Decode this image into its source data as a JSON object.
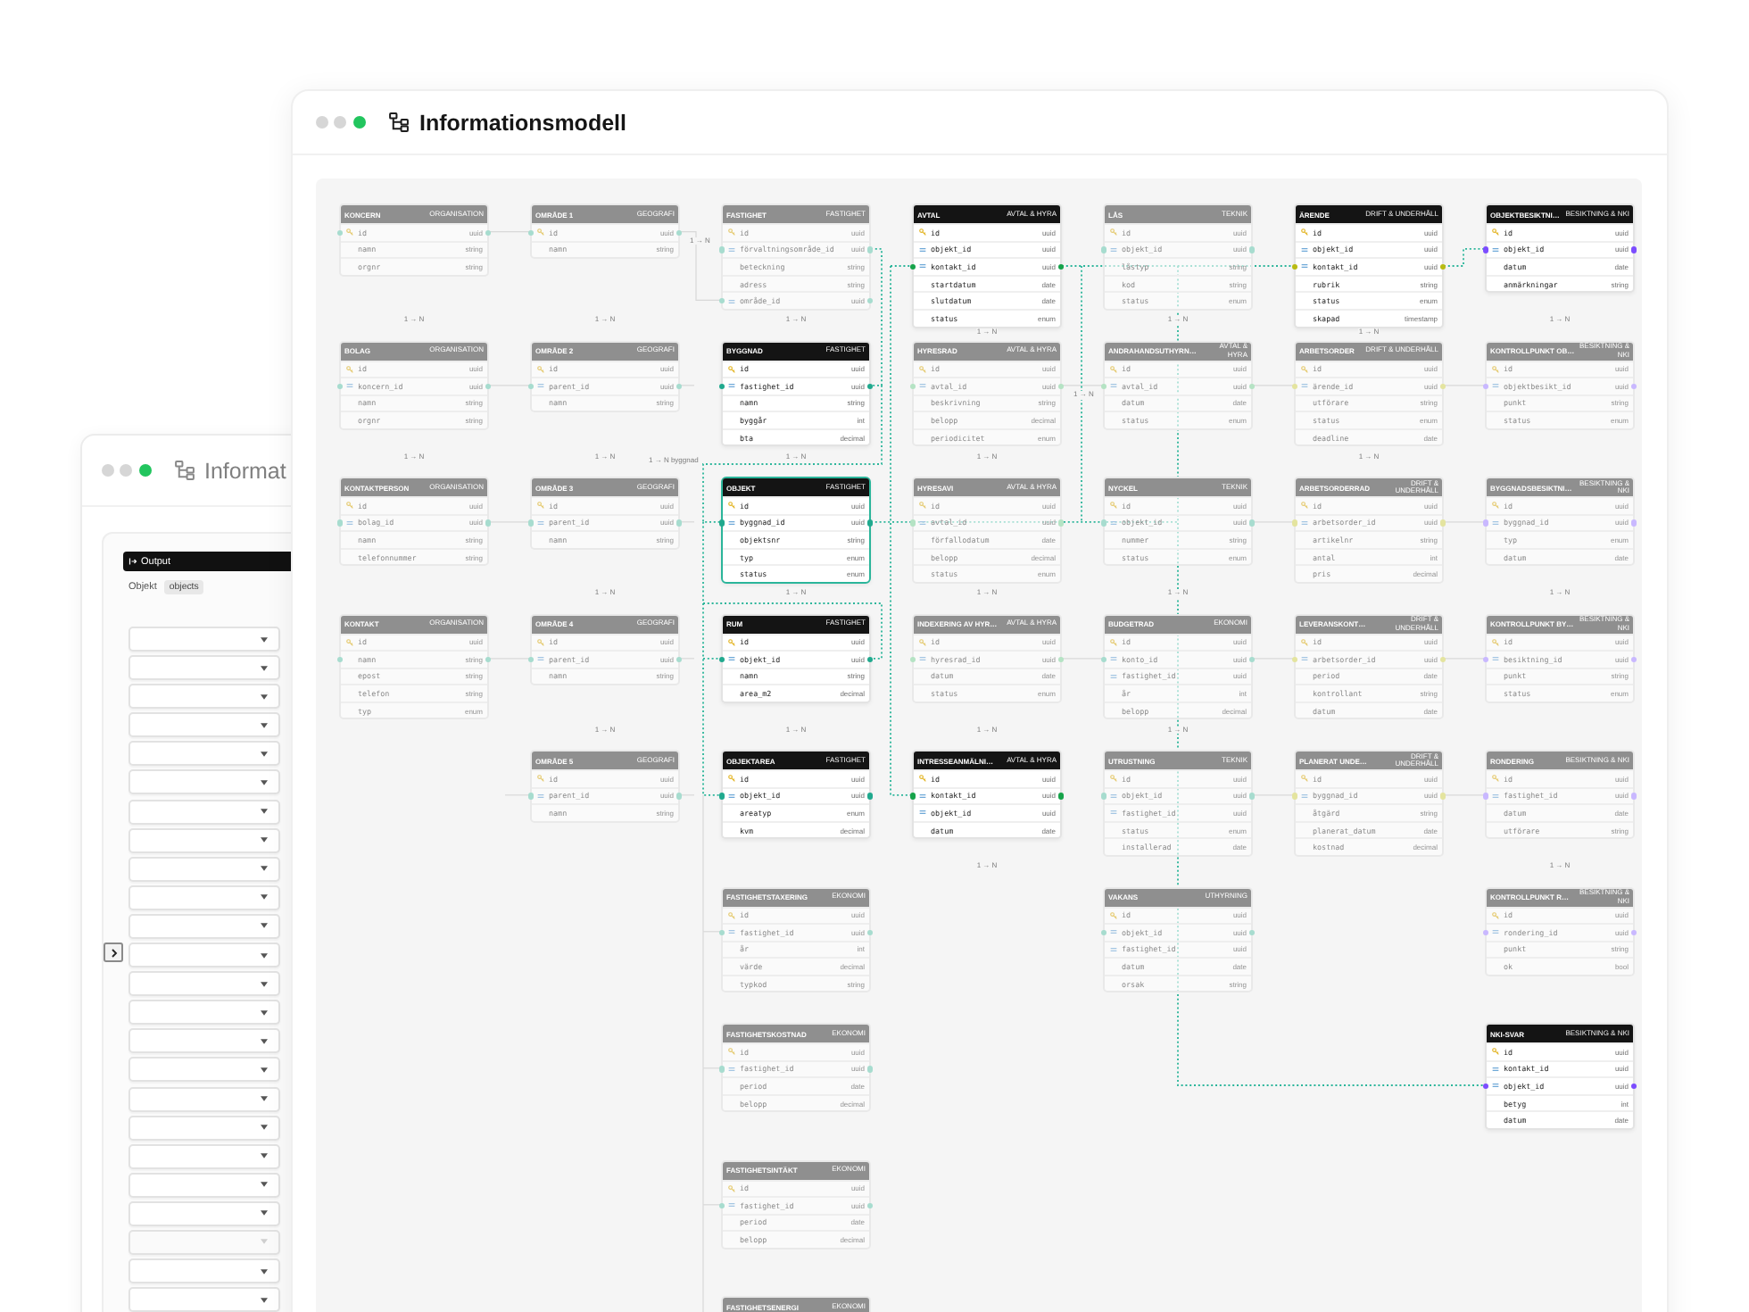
{
  "back_window": {
    "title": "Informat",
    "output": {
      "title": "Output",
      "object_label": "Objekt",
      "object_value": "objects",
      "dropdowns": [
        {
          "disabled": false
        },
        {
          "disabled": false
        },
        {
          "disabled": false
        },
        {
          "disabled": false
        },
        {
          "disabled": false
        },
        {
          "disabled": false
        },
        {
          "disabled": false
        },
        {
          "disabled": false
        },
        {
          "disabled": false
        },
        {
          "disabled": false
        },
        {
          "disabled": false
        },
        {
          "disabled": false
        },
        {
          "disabled": false
        },
        {
          "disabled": false
        },
        {
          "disabled": false
        },
        {
          "disabled": false
        },
        {
          "disabled": false
        },
        {
          "disabled": false
        },
        {
          "disabled": false
        },
        {
          "disabled": false
        },
        {
          "disabled": false
        },
        {
          "disabled": true
        },
        {
          "disabled": false
        },
        {
          "disabled": false
        }
      ]
    }
  },
  "window": {
    "title": "Informationsmodell"
  },
  "diagram": {
    "line_labels": [
      "1 → N",
      "1 → N",
      "1 → N byggnad"
    ],
    "columns": [
      {
        "tables": [
          {
            "title": "KONCERN",
            "group": "ORGANISATION",
            "dimmed": true,
            "selected": false,
            "color": "#a7dccf",
            "relation_label": "1 → N",
            "fields": [
              {
                "name": "id",
                "type": "uuid",
                "kind": "pk",
                "linked": true
              },
              {
                "name": "namn",
                "type": "string",
                "kind": "plain"
              },
              {
                "name": "orgnr",
                "type": "string",
                "kind": "plain"
              }
            ]
          },
          {
            "title": "BOLAG",
            "group": "ORGANISATION",
            "dimmed": true,
            "selected": false,
            "color": "#a7dccf",
            "relation_label": "1 → N",
            "fields": [
              {
                "name": "id",
                "type": "uuid",
                "kind": "pk"
              },
              {
                "name": "koncern_id",
                "type": "uuid",
                "kind": "fk",
                "linked": true
              },
              {
                "name": "namn",
                "type": "string",
                "kind": "plain"
              },
              {
                "name": "orgnr",
                "type": "string",
                "kind": "plain"
              }
            ]
          },
          {
            "title": "KONTAKTPERSON",
            "group": "ORGANISATION",
            "dimmed": true,
            "selected": false,
            "color": "#a7dccf",
            "fields": [
              {
                "name": "id",
                "type": "uuid",
                "kind": "pk"
              },
              {
                "name": "bolag_id",
                "type": "uuid",
                "kind": "fk",
                "linked": true
              },
              {
                "name": "namn",
                "type": "string",
                "kind": "plain"
              },
              {
                "name": "telefonnummer",
                "type": "string",
                "kind": "plain"
              }
            ]
          },
          {
            "title": "KONTAKT",
            "group": "ORGANISATION",
            "dimmed": true,
            "selected": false,
            "color": "#a7dccf",
            "fields": [
              {
                "name": "id",
                "type": "uuid",
                "kind": "pk"
              },
              {
                "name": "namn",
                "type": "string",
                "kind": "plain",
                "linked": true
              },
              {
                "name": "epost",
                "type": "string",
                "kind": "plain"
              },
              {
                "name": "telefon",
                "type": "string",
                "kind": "plain"
              },
              {
                "name": "typ",
                "type": "enum",
                "kind": "plain"
              }
            ]
          }
        ]
      },
      {
        "tables": [
          {
            "title": "OMRÅDE 1",
            "group": "GEOGRAFI",
            "dimmed": true,
            "selected": false,
            "color": "#a7dccf",
            "relation_label": "1 → N",
            "fields": [
              {
                "name": "id",
                "type": "uuid",
                "kind": "pk",
                "linked": true
              },
              {
                "name": "namn",
                "type": "string",
                "kind": "plain"
              }
            ]
          },
          {
            "title": "OMRÅDE 2",
            "group": "GEOGRAFI",
            "dimmed": true,
            "selected": false,
            "color": "#a7dccf",
            "relation_label": "1 → N",
            "fields": [
              {
                "name": "id",
                "type": "uuid",
                "kind": "pk"
              },
              {
                "name": "parent_id",
                "type": "uuid",
                "kind": "fk",
                "linked": true
              },
              {
                "name": "namn",
                "type": "string",
                "kind": "plain"
              }
            ]
          },
          {
            "title": "OMRÅDE 3",
            "group": "GEOGRAFI",
            "dimmed": true,
            "selected": false,
            "color": "#a7dccf",
            "relation_label": "1 → N",
            "fields": [
              {
                "name": "id",
                "type": "uuid",
                "kind": "pk"
              },
              {
                "name": "parent_id",
                "type": "uuid",
                "kind": "fk",
                "linked": true
              },
              {
                "name": "namn",
                "type": "string",
                "kind": "plain"
              }
            ]
          },
          {
            "title": "OMRÅDE 4",
            "group": "GEOGRAFI",
            "dimmed": true,
            "selected": false,
            "color": "#a7dccf",
            "relation_label": "1 → N",
            "fields": [
              {
                "name": "id",
                "type": "uuid",
                "kind": "pk"
              },
              {
                "name": "parent_id",
                "type": "uuid",
                "kind": "fk",
                "linked": true
              },
              {
                "name": "namn",
                "type": "string",
                "kind": "plain"
              }
            ]
          },
          {
            "title": "OMRÅDE 5",
            "group": "GEOGRAFI",
            "dimmed": true,
            "selected": false,
            "color": "#a7dccf",
            "fields": [
              {
                "name": "id",
                "type": "uuid",
                "kind": "pk"
              },
              {
                "name": "parent_id",
                "type": "uuid",
                "kind": "fk",
                "linked": true
              },
              {
                "name": "namn",
                "type": "string",
                "kind": "plain"
              }
            ]
          }
        ]
      },
      {
        "tables": [
          {
            "title": "FASTIGHET",
            "group": "FASTIGHET",
            "dimmed": true,
            "selected": false,
            "color": "#a7dccf",
            "relation_label": "1 → N",
            "fields": [
              {
                "name": "id",
                "type": "uuid",
                "kind": "pk"
              },
              {
                "name": "förvaltningsområde_id",
                "type": "uuid",
                "kind": "fk",
                "linked": true
              },
              {
                "name": "beteckning",
                "type": "string",
                "kind": "plain"
              },
              {
                "name": "adress",
                "type": "string",
                "kind": "plain"
              },
              {
                "name": "område_id",
                "type": "uuid",
                "kind": "fk",
                "linked": true
              }
            ]
          },
          {
            "title": "BYGGNAD",
            "group": "FASTIGHET",
            "dimmed": false,
            "selected": false,
            "color": "#20a98e",
            "relation_label": "1 → N",
            "fields": [
              {
                "name": "id",
                "type": "uuid",
                "kind": "pk"
              },
              {
                "name": "fastighet_id",
                "type": "uuid",
                "kind": "fk",
                "linked": true
              },
              {
                "name": "namn",
                "type": "string",
                "kind": "plain"
              },
              {
                "name": "byggår",
                "type": "int",
                "kind": "plain"
              },
              {
                "name": "bta",
                "type": "decimal",
                "kind": "plain"
              }
            ]
          },
          {
            "title": "OBJEKT",
            "group": "FASTIGHET",
            "dimmed": false,
            "selected": true,
            "color": "#20a98e",
            "relation_label": "1 → N",
            "fields": [
              {
                "name": "id",
                "type": "uuid",
                "kind": "pk"
              },
              {
                "name": "byggnad_id",
                "type": "uuid",
                "kind": "fk",
                "linked": true
              },
              {
                "name": "objektsnr",
                "type": "string",
                "kind": "plain"
              },
              {
                "name": "typ",
                "type": "enum",
                "kind": "plain"
              },
              {
                "name": "status",
                "type": "enum",
                "kind": "plain"
              }
            ]
          },
          {
            "title": "RUM",
            "group": "FASTIGHET",
            "dimmed": false,
            "selected": false,
            "color": "#20a98e",
            "relation_label": "1 → N",
            "fields": [
              {
                "name": "id",
                "type": "uuid",
                "kind": "pk"
              },
              {
                "name": "objekt_id",
                "type": "uuid",
                "kind": "fk",
                "linked": true
              },
              {
                "name": "namn",
                "type": "string",
                "kind": "plain"
              },
              {
                "name": "area_m2",
                "type": "decimal",
                "kind": "plain"
              }
            ]
          },
          {
            "title": "OBJEKTAREA",
            "group": "FASTIGHET",
            "dimmed": false,
            "selected": false,
            "color": "#20a98e",
            "fields": [
              {
                "name": "id",
                "type": "uuid",
                "kind": "pk"
              },
              {
                "name": "objekt_id",
                "type": "uuid",
                "kind": "fk",
                "linked": true
              },
              {
                "name": "areatyp",
                "type": "enum",
                "kind": "plain"
              },
              {
                "name": "kvm",
                "type": "decimal",
                "kind": "plain"
              }
            ]
          },
          {
            "title": "FASTIGHETSTAXERING",
            "group": "EKONOMI",
            "dimmed": true,
            "selected": false,
            "color": "#a7dccf",
            "fields": [
              {
                "name": "id",
                "type": "uuid",
                "kind": "pk"
              },
              {
                "name": "fastighet_id",
                "type": "uuid",
                "kind": "fk",
                "linked": true
              },
              {
                "name": "år",
                "type": "int",
                "kind": "plain"
              },
              {
                "name": "värde",
                "type": "decimal",
                "kind": "plain"
              },
              {
                "name": "typkod",
                "type": "string",
                "kind": "plain"
              }
            ]
          },
          {
            "title": "FASTIGHETSKOSTNAD",
            "group": "EKONOMI",
            "dimmed": true,
            "selected": false,
            "color": "#a7dccf",
            "fields": [
              {
                "name": "id",
                "type": "uuid",
                "kind": "pk"
              },
              {
                "name": "fastighet_id",
                "type": "uuid",
                "kind": "fk",
                "linked": true
              },
              {
                "name": "period",
                "type": "date",
                "kind": "plain"
              },
              {
                "name": "belopp",
                "type": "decimal",
                "kind": "plain"
              }
            ]
          },
          {
            "title": "FASTIGHETSINTÄKT",
            "group": "EKONOMI",
            "dimmed": true,
            "selected": false,
            "color": "#a7dccf",
            "fields": [
              {
                "name": "id",
                "type": "uuid",
                "kind": "pk"
              },
              {
                "name": "fastighet_id",
                "type": "uuid",
                "kind": "fk",
                "linked": true
              },
              {
                "name": "period",
                "type": "date",
                "kind": "plain"
              },
              {
                "name": "belopp",
                "type": "decimal",
                "kind": "plain"
              }
            ]
          },
          {
            "title": "FASTIGHETSENERGI",
            "group": "EKONOMI",
            "dimmed": true,
            "selected": false
          }
        ]
      },
      {
        "tables": [
          {
            "title": "AVTAL",
            "group": "AVTAL & HYRA",
            "dimmed": false,
            "selected": false,
            "color": "#16a34a",
            "relation_label": "1 → N",
            "fields": [
              {
                "name": "id",
                "type": "uuid",
                "kind": "pk"
              },
              {
                "name": "objekt_id",
                "type": "uuid",
                "kind": "fk"
              },
              {
                "name": "kontakt_id",
                "type": "uuid",
                "kind": "fk",
                "linked": true
              },
              {
                "name": "startdatum",
                "type": "date",
                "kind": "plain"
              },
              {
                "name": "slutdatum",
                "type": "date",
                "kind": "plain"
              },
              {
                "name": "status",
                "type": "enum",
                "kind": "plain"
              }
            ]
          },
          {
            "title": "HYRESRAD",
            "group": "AVTAL & HYRA",
            "dimmed": true,
            "selected": false,
            "color": "#b5e3c4",
            "relation_label": "1 → N",
            "fields": [
              {
                "name": "id",
                "type": "uuid",
                "kind": "pk"
              },
              {
                "name": "avtal_id",
                "type": "uuid",
                "kind": "fk",
                "linked": true
              },
              {
                "name": "beskrivning",
                "type": "string",
                "kind": "plain"
              },
              {
                "name": "belopp",
                "type": "decimal",
                "kind": "plain"
              },
              {
                "name": "periodicitet",
                "type": "enum",
                "kind": "plain"
              }
            ]
          },
          {
            "title": "HYRESAVI",
            "group": "AVTAL & HYRA",
            "dimmed": true,
            "selected": false,
            "color": "#b5e3c4",
            "relation_label": "1 → N",
            "fields": [
              {
                "name": "id",
                "type": "uuid",
                "kind": "pk"
              },
              {
                "name": "avtal_id",
                "type": "uuid",
                "kind": "fk",
                "linked": true
              },
              {
                "name": "förfallodatum",
                "type": "date",
                "kind": "plain"
              },
              {
                "name": "belopp",
                "type": "decimal",
                "kind": "plain"
              },
              {
                "name": "status",
                "type": "enum",
                "kind": "plain"
              }
            ]
          },
          {
            "title": "INDEXERING AV HYR…",
            "group": "AVTAL & HYRA",
            "dimmed": true,
            "selected": false,
            "color": "#b5e3c4",
            "relation_label": "1 → N",
            "fields": [
              {
                "name": "id",
                "type": "uuid",
                "kind": "pk"
              },
              {
                "name": "hyresrad_id",
                "type": "uuid",
                "kind": "fk",
                "linked": true
              },
              {
                "name": "datum",
                "type": "date",
                "kind": "plain"
              },
              {
                "name": "status",
                "type": "enum",
                "kind": "plain"
              }
            ]
          },
          {
            "title": "INTRESSEANMÄLNI…",
            "group": "AVTAL & HYRA",
            "dimmed": false,
            "selected": false,
            "color": "#16a34a",
            "relation_label": "1 → N",
            "fields": [
              {
                "name": "id",
                "type": "uuid",
                "kind": "pk"
              },
              {
                "name": "kontakt_id",
                "type": "uuid",
                "kind": "fk",
                "linked": true
              },
              {
                "name": "objekt_id",
                "type": "uuid",
                "kind": "fk"
              },
              {
                "name": "datum",
                "type": "date",
                "kind": "plain"
              }
            ]
          }
        ]
      },
      {
        "tables": [
          {
            "title": "LÅS",
            "group": "TEKNIK",
            "dimmed": true,
            "selected": false,
            "color": "#a7dccf",
            "relation_label": "1 → N",
            "fields": [
              {
                "name": "id",
                "type": "uuid",
                "kind": "pk"
              },
              {
                "name": "objekt_id",
                "type": "uuid",
                "kind": "fk",
                "linked": true
              },
              {
                "name": "låstyp",
                "type": "string",
                "kind": "plain"
              },
              {
                "name": "kod",
                "type": "string",
                "kind": "plain"
              },
              {
                "name": "status",
                "type": "enum",
                "kind": "plain"
              }
            ]
          },
          {
            "title": "ANDRAHANDSUTHYRN…",
            "group": "AVTAL & HYRA",
            "dimmed": true,
            "selected": false,
            "color": "#b5e3c4",
            "fields": [
              {
                "name": "id",
                "type": "uuid",
                "kind": "pk"
              },
              {
                "name": "avtal_id",
                "type": "uuid",
                "kind": "fk",
                "linked": true
              },
              {
                "name": "datum",
                "type": "date",
                "kind": "plain"
              },
              {
                "name": "status",
                "type": "enum",
                "kind": "plain"
              }
            ]
          },
          {
            "title": "NYCKEL",
            "group": "TEKNIK",
            "dimmed": true,
            "selected": false,
            "color": "#a7dccf",
            "relation_label": "1 → N",
            "fields": [
              {
                "name": "id",
                "type": "uuid",
                "kind": "pk"
              },
              {
                "name": "objekt_id",
                "type": "uuid",
                "kind": "fk",
                "linked": true
              },
              {
                "name": "nummer",
                "type": "string",
                "kind": "plain"
              },
              {
                "name": "status",
                "type": "enum",
                "kind": "plain"
              }
            ]
          },
          {
            "title": "BUDGETRAD",
            "group": "EKONOMI",
            "dimmed": true,
            "selected": false,
            "color": "#a7dccf",
            "relation_label": "1 → N",
            "fields": [
              {
                "name": "id",
                "type": "uuid",
                "kind": "pk"
              },
              {
                "name": "konto_id",
                "type": "uuid",
                "kind": "fk",
                "linked": true
              },
              {
                "name": "fastighet_id",
                "type": "uuid",
                "kind": "fk"
              },
              {
                "name": "år",
                "type": "int",
                "kind": "plain"
              },
              {
                "name": "belopp",
                "type": "decimal",
                "kind": "plain"
              }
            ]
          },
          {
            "title": "UTRUSTNING",
            "group": "TEKNIK",
            "dimmed": true,
            "selected": false,
            "color": "#a7dccf",
            "fields": [
              {
                "name": "id",
                "type": "uuid",
                "kind": "pk"
              },
              {
                "name": "objekt_id",
                "type": "uuid",
                "kind": "fk",
                "linked": true
              },
              {
                "name": "fastighet_id",
                "type": "uuid",
                "kind": "fk"
              },
              {
                "name": "status",
                "type": "enum",
                "kind": "plain"
              },
              {
                "name": "installerad",
                "type": "date",
                "kind": "plain"
              }
            ]
          },
          {
            "title": "VAKANS",
            "group": "UTHYRNING",
            "dimmed": true,
            "selected": false,
            "color": "#a7dccf",
            "fields": [
              {
                "name": "id",
                "type": "uuid",
                "kind": "pk"
              },
              {
                "name": "objekt_id",
                "type": "uuid",
                "kind": "fk",
                "linked": true
              },
              {
                "name": "fastighet_id",
                "type": "uuid",
                "kind": "fk"
              },
              {
                "name": "datum",
                "type": "date",
                "kind": "plain"
              },
              {
                "name": "orsak",
                "type": "string",
                "kind": "plain"
              }
            ]
          }
        ]
      },
      {
        "tables": [
          {
            "title": "ÄRENDE",
            "group": "DRIFT & UNDERHÅLL",
            "dimmed": false,
            "selected": false,
            "color": "#b9bb12",
            "relation_label": "1 → N",
            "fields": [
              {
                "name": "id",
                "type": "uuid",
                "kind": "pk"
              },
              {
                "name": "objekt_id",
                "type": "uuid",
                "kind": "fk"
              },
              {
                "name": "kontakt_id",
                "type": "uuid",
                "kind": "fk",
                "linked": true
              },
              {
                "name": "rubrik",
                "type": "string",
                "kind": "plain"
              },
              {
                "name": "status",
                "type": "enum",
                "kind": "plain"
              },
              {
                "name": "skapad",
                "type": "timestamp",
                "kind": "plain"
              }
            ]
          },
          {
            "title": "ARBETSORDER",
            "group": "DRIFT & UNDERHÅLL",
            "dimmed": true,
            "selected": false,
            "color": "#e4e49f",
            "relation_label": "1 → N",
            "fields": [
              {
                "name": "id",
                "type": "uuid",
                "kind": "pk"
              },
              {
                "name": "ärende_id",
                "type": "uuid",
                "kind": "fk",
                "linked": true
              },
              {
                "name": "utförare",
                "type": "string",
                "kind": "plain"
              },
              {
                "name": "status",
                "type": "enum",
                "kind": "plain"
              },
              {
                "name": "deadline",
                "type": "date",
                "kind": "plain"
              }
            ]
          },
          {
            "title": "ARBETSORDERRAD",
            "group": "DRIFT & UNDERHÅLL",
            "dimmed": true,
            "selected": false,
            "color": "#e4e49f",
            "fields": [
              {
                "name": "id",
                "type": "uuid",
                "kind": "pk"
              },
              {
                "name": "arbetsorder_id",
                "type": "uuid",
                "kind": "fk",
                "linked": true
              },
              {
                "name": "artikelnr",
                "type": "string",
                "kind": "plain"
              },
              {
                "name": "antal",
                "type": "int",
                "kind": "plain"
              },
              {
                "name": "pris",
                "type": "decimal",
                "kind": "plain"
              }
            ]
          },
          {
            "title": "LEVERANSKONT…",
            "group": "DRIFT & UNDERHÅLL",
            "dimmed": true,
            "selected": false,
            "color": "#e4e49f",
            "fields": [
              {
                "name": "id",
                "type": "uuid",
                "kind": "pk"
              },
              {
                "name": "arbetsorder_id",
                "type": "uuid",
                "kind": "fk",
                "linked": true
              },
              {
                "name": "period",
                "type": "date",
                "kind": "plain"
              },
              {
                "name": "kontrollant",
                "type": "string",
                "kind": "plain"
              },
              {
                "name": "datum",
                "type": "date",
                "kind": "plain"
              }
            ]
          },
          {
            "title": "PLANERAT UNDE…",
            "group": "DRIFT & UNDERHÅLL",
            "dimmed": true,
            "selected": false,
            "color": "#e4e49f",
            "fields": [
              {
                "name": "id",
                "type": "uuid",
                "kind": "pk"
              },
              {
                "name": "byggnad_id",
                "type": "uuid",
                "kind": "fk",
                "linked": true
              },
              {
                "name": "åtgärd",
                "type": "string",
                "kind": "plain"
              },
              {
                "name": "planerat_datum",
                "type": "date",
                "kind": "plain"
              },
              {
                "name": "kostnad",
                "type": "decimal",
                "kind": "plain"
              }
            ]
          }
        ]
      },
      {
        "tables": [
          {
            "title": "OBJEKTBESIKTNI…",
            "group": "BESIKTNING & NKI",
            "dimmed": false,
            "selected": false,
            "color": "#7c4dff",
            "relation_label": "1 → N",
            "fields": [
              {
                "name": "id",
                "type": "uuid",
                "kind": "pk"
              },
              {
                "name": "objekt_id",
                "type": "uuid",
                "kind": "fk",
                "linked": true
              },
              {
                "name": "datum",
                "type": "date",
                "kind": "plain"
              },
              {
                "name": "anmärkningar",
                "type": "string",
                "kind": "plain"
              }
            ]
          },
          {
            "title": "KONTROLLPUNKT OB…",
            "group": "BESIKTNING & NKI",
            "dimmed": true,
            "selected": false,
            "color": "#c9b8ff",
            "fields": [
              {
                "name": "id",
                "type": "uuid",
                "kind": "pk"
              },
              {
                "name": "objektbesikt_id",
                "type": "uuid",
                "kind": "fk",
                "linked": true
              },
              {
                "name": "punkt",
                "type": "string",
                "kind": "plain"
              },
              {
                "name": "status",
                "type": "enum",
                "kind": "plain"
              }
            ]
          },
          {
            "title": "BYGGNADSBESIKTNI…",
            "group": "BESIKTNING & NKI",
            "dimmed": true,
            "selected": false,
            "color": "#c9b8ff",
            "relation_label": "1 → N",
            "fields": [
              {
                "name": "id",
                "type": "uuid",
                "kind": "pk"
              },
              {
                "name": "byggnad_id",
                "type": "uuid",
                "kind": "fk",
                "linked": true
              },
              {
                "name": "typ",
                "type": "enum",
                "kind": "plain"
              },
              {
                "name": "datum",
                "type": "date",
                "kind": "plain"
              }
            ]
          },
          {
            "title": "KONTROLLPUNKT BY…",
            "group": "BESIKTNING & NKI",
            "dimmed": true,
            "selected": false,
            "color": "#c9b8ff",
            "fields": [
              {
                "name": "id",
                "type": "uuid",
                "kind": "pk"
              },
              {
                "name": "besiktning_id",
                "type": "uuid",
                "kind": "fk",
                "linked": true
              },
              {
                "name": "punkt",
                "type": "string",
                "kind": "plain"
              },
              {
                "name": "status",
                "type": "enum",
                "kind": "plain"
              }
            ]
          },
          {
            "title": "RONDERING",
            "group": "BESIKTNING & NKI",
            "dimmed": true,
            "selected": false,
            "color": "#c9b8ff",
            "relation_label": "1 → N",
            "fields": [
              {
                "name": "id",
                "type": "uuid",
                "kind": "pk"
              },
              {
                "name": "fastighet_id",
                "type": "uuid",
                "kind": "fk",
                "linked": true
              },
              {
                "name": "datum",
                "type": "date",
                "kind": "plain"
              },
              {
                "name": "utförare",
                "type": "string",
                "kind": "plain"
              }
            ]
          },
          {
            "title": "KONTROLLPUNKT R…",
            "group": "BESIKTNING & NKI",
            "dimmed": true,
            "selected": false,
            "color": "#c9b8ff",
            "fields": [
              {
                "name": "id",
                "type": "uuid",
                "kind": "pk"
              },
              {
                "name": "rondering_id",
                "type": "uuid",
                "kind": "fk",
                "linked": true
              },
              {
                "name": "punkt",
                "type": "string",
                "kind": "plain"
              },
              {
                "name": "ok",
                "type": "bool",
                "kind": "plain"
              }
            ]
          },
          {
            "title": "NKI-SVAR",
            "group": "BESIKTNING & NKI",
            "dimmed": false,
            "selected": false,
            "color": "#7c4dff",
            "fields": [
              {
                "name": "id",
                "type": "uuid",
                "kind": "pk"
              },
              {
                "name": "kontakt_id",
                "type": "uuid",
                "kind": "fk"
              },
              {
                "name": "objekt_id",
                "type": "uuid",
                "kind": "fk",
                "linked": true
              },
              {
                "name": "betyg",
                "type": "int",
                "kind": "plain"
              },
              {
                "name": "datum",
                "type": "date",
                "kind": "plain"
              }
            ]
          }
        ]
      }
    ]
  }
}
